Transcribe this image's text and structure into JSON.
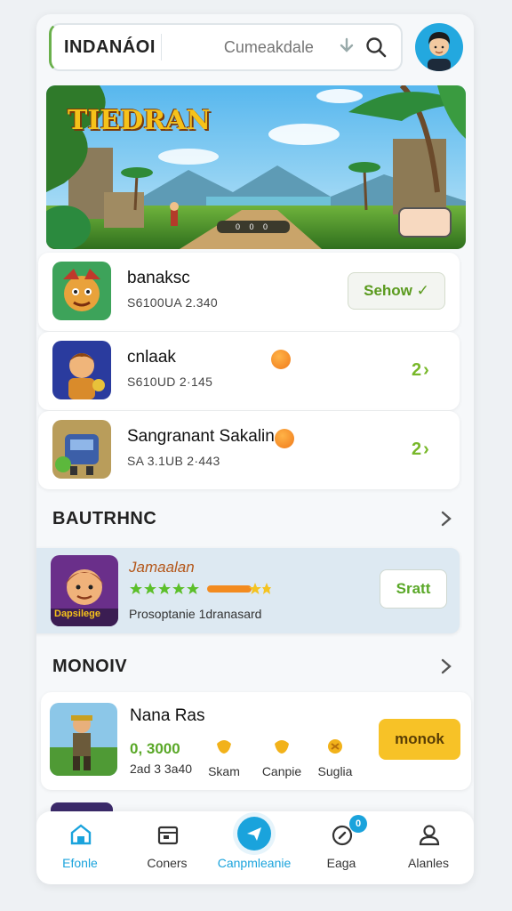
{
  "header": {
    "app_title": "INDANÁOI",
    "search_placeholder": "Cumeakdale",
    "download_icon": "download-icon",
    "search_icon": "search-icon"
  },
  "banner": {
    "title": "TIEDRAN",
    "pager_text": "0 0 0",
    "badge_text": ""
  },
  "games": [
    {
      "name": "banaksc",
      "meta": "S6100UA 2.340",
      "action_label": "Sehow ✓",
      "action_type": "button"
    },
    {
      "name": "cnlaak",
      "meta": "S610UD 2·145",
      "action_label": "2",
      "action_type": "chevron"
    },
    {
      "name": "Sangranant Sakalin",
      "meta": "SA 3.1UB 2·443",
      "action_label": "2",
      "action_type": "chevron"
    }
  ],
  "sections": {
    "featured_title": "BAUTRHNC",
    "more_title": "MONOIV"
  },
  "featured": {
    "name": "Jamaalan",
    "tagline": "Prosoptanie 1dranasard",
    "thumb_text": "Dapsilege",
    "action_label": "Sratt",
    "rating": 4.5
  },
  "more_game": {
    "name": "Nana Ras",
    "score": "0, 3000",
    "meta": "2ad 3 3a40",
    "stats": [
      {
        "label": "Skam"
      },
      {
        "label": "Canpie"
      },
      {
        "label": "Suglia"
      }
    ],
    "action_label": "monok"
  },
  "nav": [
    {
      "label": "Efonle",
      "icon": "home-icon",
      "active": false
    },
    {
      "label": "Coners",
      "icon": "calendar-icon",
      "active": false
    },
    {
      "label": "Canpmleanie",
      "icon": "send-icon",
      "active": true
    },
    {
      "label": "Eaga",
      "icon": "compass-icon",
      "badge": "0",
      "active": false
    },
    {
      "label": "Alanles",
      "icon": "user-icon",
      "active": false
    }
  ],
  "colors": {
    "accent_green": "#78b82a",
    "accent_blue": "#1aa3dc",
    "gold_button": "#f7c227"
  }
}
